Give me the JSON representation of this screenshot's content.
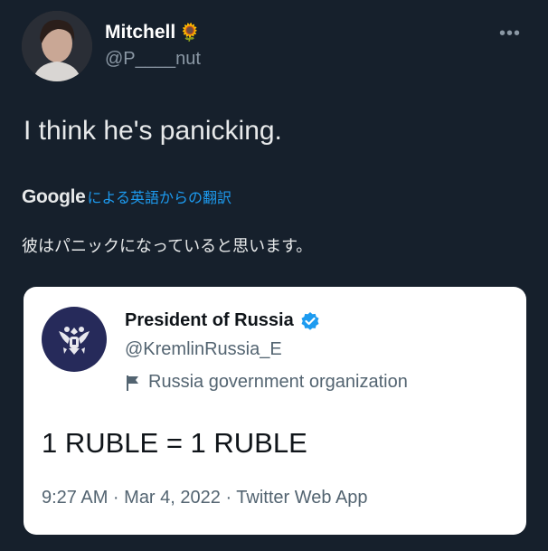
{
  "tweet": {
    "author_name": "Mitchell",
    "author_emoji": "🌻",
    "author_handle": "@P____nut",
    "more_icon": "more-horizontal-icon",
    "text": "I think he's panicking.",
    "translation": {
      "provider": "Google",
      "label": "による英語からの翻訳",
      "text": "彼はパニックになっていると思います。"
    }
  },
  "quote": {
    "name": "President of Russia",
    "handle": "@KremlinRussia_E",
    "label": "Russia government organization",
    "text": "1 RUBLE = 1 RUBLE",
    "meta": "9:27 AM · Mar 4, 2022 · Twitter Web App",
    "verified_color": "#1d9bf0"
  },
  "colors": {
    "background": "#16202c",
    "link": "#1d9bf0",
    "secondary_text": "#8b98a5"
  }
}
